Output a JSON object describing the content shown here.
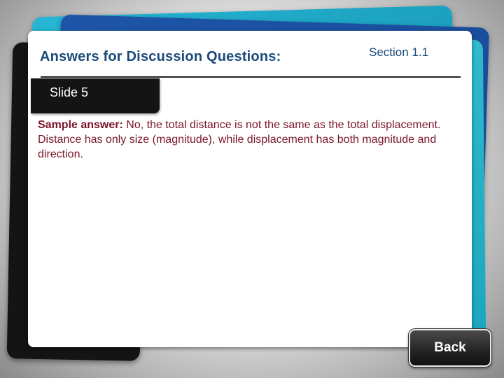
{
  "slide": {
    "title": "Answers for Discussion Questions:",
    "section": "Section 1.1",
    "tab_label": "Slide 5"
  },
  "answer": {
    "lead": "Sample answer:",
    "body": " No, the total distance is not the same as the total displacement. Distance has only size (magnitude), while displacement has both magnitude and direction."
  },
  "navigation": {
    "back_label": "Back"
  },
  "colors": {
    "title": "#1a4a7a",
    "answer_text": "#7a1528",
    "tab_background": "#141414",
    "card_cyan": "#27b6d3",
    "card_blue": "#1e55a8"
  }
}
